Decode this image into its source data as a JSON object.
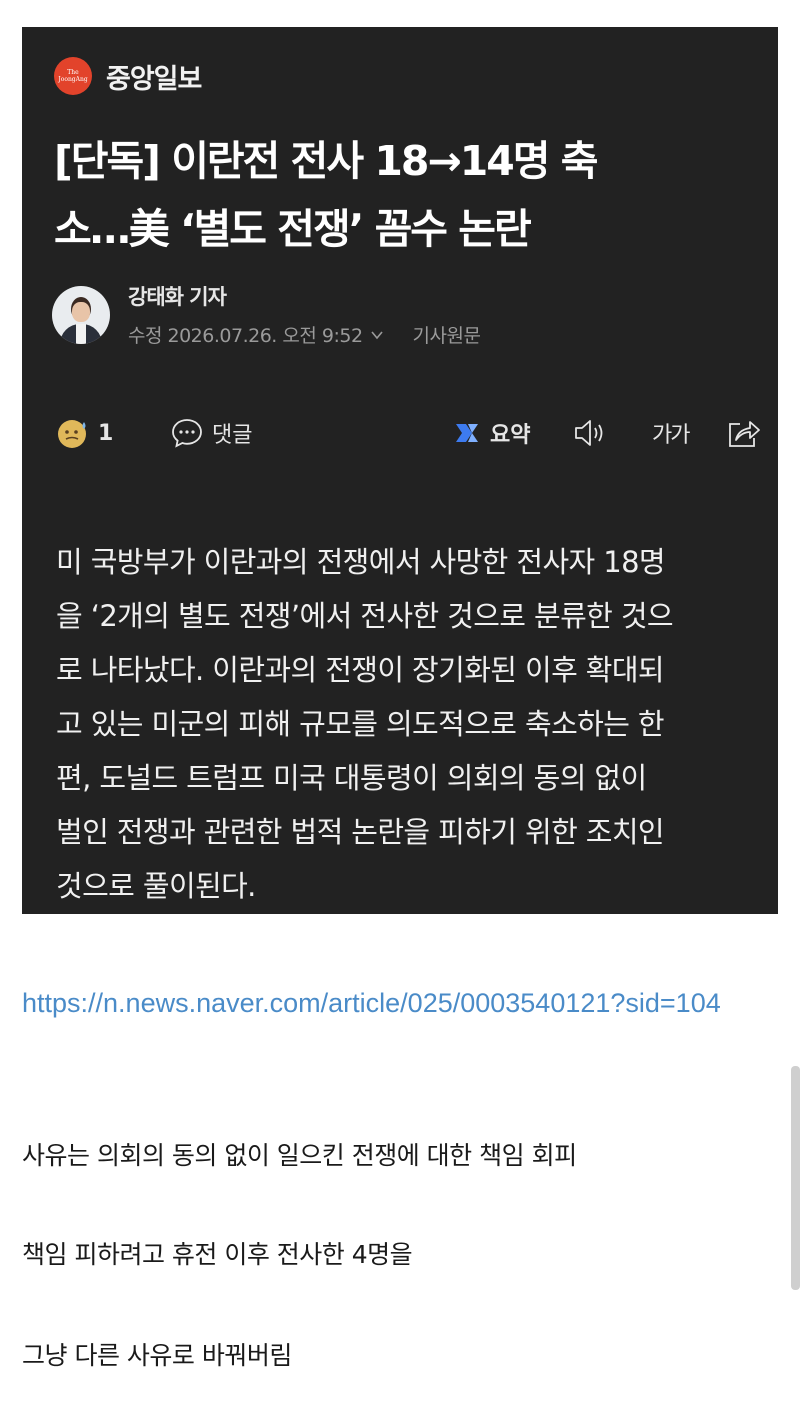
{
  "article": {
    "publisher": "중앙일보",
    "publisher_logo_text": "The JoongAng",
    "headline_line1": "[단독] 이란전 전사 18→14명 축",
    "headline_line2": "소…美 ‘별도 전쟁’ 꼼수 논란",
    "author": "강태화 기자",
    "timestamp": "수정 2026.07.26. 오전 9:52",
    "original_label": "기사원문",
    "toolbar": {
      "reaction_count": "1",
      "comment_label": "댓글",
      "summary_label": "요약",
      "font_label": "가가"
    },
    "body_lines": [
      "미 국방부가 이란과의 전쟁에서 사망한 전사자 18명",
      "을 ‘2개의 별도 전쟁’에서 전사한 것으로 분류한 것으",
      "로 나타났다. 이란과의 전쟁이 장기화된 이후 확대되",
      "고 있는 미군의 피해 규모를 의도적으로 축소하는 한",
      "편, 도널드 트럼프 미국 대통령이 의회의 동의 없이",
      "벌인 전쟁과 관련한 법적 논란을 피하기 위한 조치인",
      "것으로 풀이된다."
    ]
  },
  "post": {
    "link": "https://n.news.naver.com/article/025/0003540121?sid=104",
    "paragraphs": [
      "사유는 의회의 동의 없이 일으킨 전쟁에 대한 책임 회피",
      "책임 피하려고 휴전 이후 전사한 4명을",
      "그냥 다른 사유로 바꿔버림"
    ]
  },
  "colors": {
    "card_bg": "#222222",
    "publisher_logo": "#e2432b",
    "link": "#4a8bc8",
    "summary_icon": "#3d7bf0"
  }
}
